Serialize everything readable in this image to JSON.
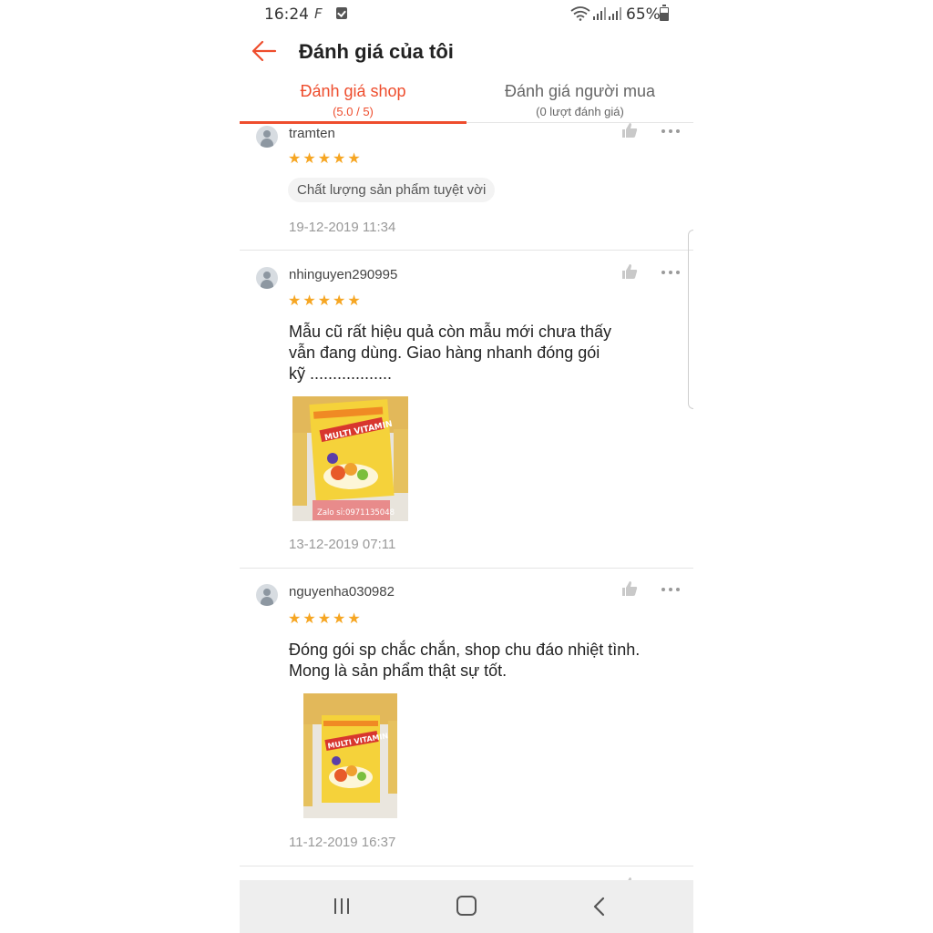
{
  "status_bar": {
    "time": "16:24",
    "app_icon": "F",
    "battery": "65%",
    "battery_level": 0.65
  },
  "header": {
    "title": "Đánh giá của tôi",
    "accent_color": "#ee4d2d"
  },
  "tabs": [
    {
      "label": "Đánh giá shop",
      "sub": "(5.0 / 5)",
      "active": true
    },
    {
      "label": "Đánh giá người mua",
      "sub": "(0 lượt đánh giá)",
      "active": false
    }
  ],
  "reviews": [
    {
      "username": "tramten",
      "rating": 5,
      "stars": "★★★★★",
      "tag": "Chất lượng sản phẩm tuyệt vời",
      "date": "19-12-2019 11:34"
    },
    {
      "username": "nhinguyen290995",
      "rating": 5,
      "stars": "★★★★★",
      "comment": "Mẫu cũ rất hiệu quả còn mẫu mới chưa thấy\nvẫn đang dùng. Giao hàng nhanh  đóng gói\nkỹ  ..................",
      "photo": {
        "product": "MULTI VITAMIN",
        "overlay": "Zalo sỉ:0971135048"
      },
      "date": "13-12-2019 07:11"
    },
    {
      "username": "nguyenha030982",
      "rating": 5,
      "stars": "★★★★★",
      "comment": "Đóng gói sp chắc chắn, shop chu đáo nhiệt tình.\nMong là sản phẩm thật sự tốt.",
      "photo": {
        "product": "MULTI VITAMIN"
      },
      "date": "11-12-2019 16:37"
    }
  ],
  "icons": {
    "back": "back-arrow-icon",
    "like": "thumbs-up-icon",
    "more": "more-dots-icon",
    "avatar": "user-avatar-icon"
  }
}
